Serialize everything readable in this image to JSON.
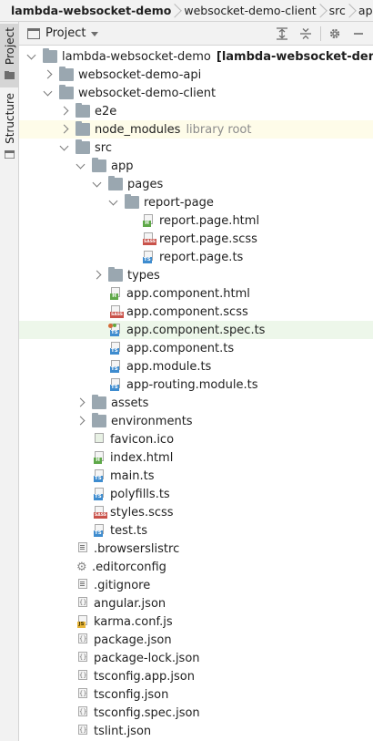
{
  "breadcrumb": [
    "lambda-websocket-demo",
    "websocket-demo-client",
    "src",
    "app",
    "p"
  ],
  "side": {
    "project_tab": "Project",
    "structure_tab": "Structure"
  },
  "header": {
    "title": "Project"
  },
  "colors": {
    "ts": "#3e8ccf",
    "html": "#5ea848",
    "sass": "#c9524a",
    "js": "#e8b63a",
    "folder": "#9aa7b0",
    "highlight_yellow": "#fefce9",
    "highlight_green": "#edf7ea"
  },
  "tree": [
    {
      "label": "lambda-websocket-demo",
      "suffix": "[lambda-websocket-demo ]",
      "type": "folder",
      "level": 0,
      "arrow": "down"
    },
    {
      "label": "websocket-demo-api",
      "type": "folder",
      "level": 1,
      "arrow": "right"
    },
    {
      "label": "websocket-demo-client",
      "type": "folder",
      "level": 1,
      "arrow": "down"
    },
    {
      "label": "e2e",
      "type": "folder",
      "level": 2,
      "arrow": "right"
    },
    {
      "label": "node_modules",
      "suffix": "library root",
      "type": "folder",
      "level": 2,
      "arrow": "right",
      "highlight": "yellow"
    },
    {
      "label": "src",
      "type": "folder",
      "level": 2,
      "arrow": "down"
    },
    {
      "label": "app",
      "type": "folder",
      "level": 3,
      "arrow": "down"
    },
    {
      "label": "pages",
      "type": "folder",
      "level": 4,
      "arrow": "down"
    },
    {
      "label": "report-page",
      "type": "folder",
      "level": 5,
      "arrow": "down"
    },
    {
      "label": "report.page.html",
      "type": "html",
      "level": 6
    },
    {
      "label": "report.page.scss",
      "type": "sass",
      "level": 6
    },
    {
      "label": "report.page.ts",
      "type": "ts",
      "level": 6
    },
    {
      "label": "types",
      "type": "folder",
      "level": 4,
      "arrow": "right"
    },
    {
      "label": "app.component.html",
      "type": "html",
      "level": 4
    },
    {
      "label": "app.component.scss",
      "type": "sass",
      "level": 4
    },
    {
      "label": "app.component.spec.ts",
      "type": "spec",
      "level": 4,
      "highlight": "green"
    },
    {
      "label": "app.component.ts",
      "type": "ts",
      "level": 4
    },
    {
      "label": "app.module.ts",
      "type": "ts",
      "level": 4
    },
    {
      "label": "app-routing.module.ts",
      "type": "ts",
      "level": 4
    },
    {
      "label": "assets",
      "type": "folder",
      "level": 3,
      "arrow": "right"
    },
    {
      "label": "environments",
      "type": "folder",
      "level": 3,
      "arrow": "right"
    },
    {
      "label": "favicon.ico",
      "type": "image",
      "level": 3
    },
    {
      "label": "index.html",
      "type": "html",
      "level": 3
    },
    {
      "label": "main.ts",
      "type": "ts",
      "level": 3
    },
    {
      "label": "polyfills.ts",
      "type": "ts",
      "level": 3
    },
    {
      "label": "styles.scss",
      "type": "sass",
      "level": 3
    },
    {
      "label": "test.ts",
      "type": "ts",
      "level": 3
    },
    {
      "label": ".browserslistrc",
      "type": "text",
      "level": 2
    },
    {
      "label": ".editorconfig",
      "type": "config",
      "level": 2
    },
    {
      "label": ".gitignore",
      "type": "text",
      "level": 2
    },
    {
      "label": "angular.json",
      "type": "json",
      "level": 2
    },
    {
      "label": "karma.conf.js",
      "type": "js",
      "level": 2
    },
    {
      "label": "package.json",
      "type": "json",
      "level": 2
    },
    {
      "label": "package-lock.json",
      "type": "json",
      "level": 2
    },
    {
      "label": "tsconfig.app.json",
      "type": "json",
      "level": 2
    },
    {
      "label": "tsconfig.json",
      "type": "json",
      "level": 2
    },
    {
      "label": "tsconfig.spec.json",
      "type": "json",
      "level": 2
    },
    {
      "label": "tslint.json",
      "type": "json",
      "level": 2
    }
  ]
}
